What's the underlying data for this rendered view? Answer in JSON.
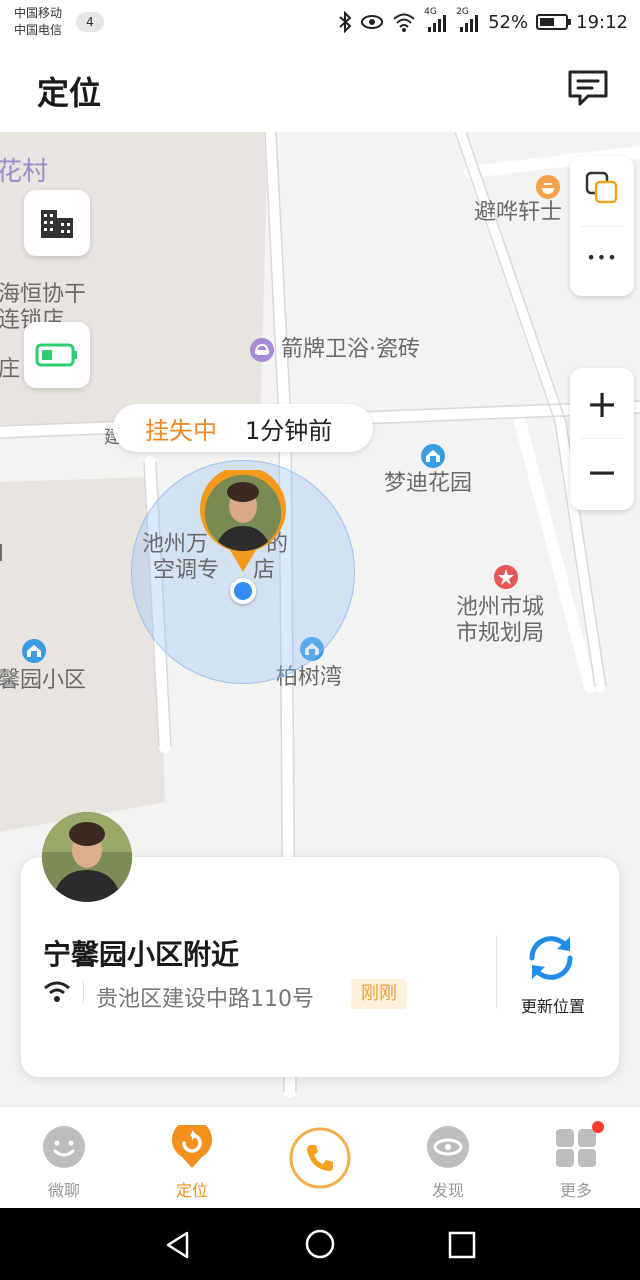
{
  "status_bar": {
    "carrier_1": "中国移动",
    "carrier_2": "中国电信",
    "sim_badge": "4",
    "network_1": "4G",
    "network_2": "2G",
    "battery": "52%",
    "time": "19:12"
  },
  "header": {
    "title": "定位",
    "message_icon": "message-icon"
  },
  "map": {
    "labels": {
      "village": "花村",
      "store_1": "海恒协干",
      "store_2": "连锁店",
      "store_3": "庄",
      "tile_poi": "箭牌卫浴·瓷砖",
      "pavilion": "避哗轩士",
      "garden": "梦迪花园",
      "ac_shop_1": "池州万",
      "ac_shop_1b": "的",
      "ac_shop_2": "空调专",
      "ac_shop_2b": "店",
      "planning_1": "池州市城",
      "planning_2": "市规划局",
      "community": "馨园小区",
      "bay": "柏树湾",
      "road_char": "建",
      "edge_char": "d"
    },
    "bubble": {
      "status": "挂失中",
      "time": "1分钟前"
    },
    "controls": {
      "zoom_in": "+",
      "zoom_out": "−",
      "more": "•••"
    }
  },
  "card": {
    "place": "宁馨园小区附近",
    "address": "贵池区建设中路110号",
    "tag": "刚刚",
    "refresh_label": "更新位置"
  },
  "nav": {
    "items": [
      {
        "label": "微聊",
        "icon": "chat-icon"
      },
      {
        "label": "定位",
        "icon": "location-icon"
      },
      {
        "label": "",
        "icon": "phone-icon"
      },
      {
        "label": "发现",
        "icon": "discover-icon"
      },
      {
        "label": "更多",
        "icon": "more-grid-icon"
      }
    ]
  },
  "colors": {
    "accent": "#f3901d",
    "location_blue": "#2e8ef3",
    "battery_green": "#2ecc71",
    "badge_red": "#ff3b30"
  }
}
